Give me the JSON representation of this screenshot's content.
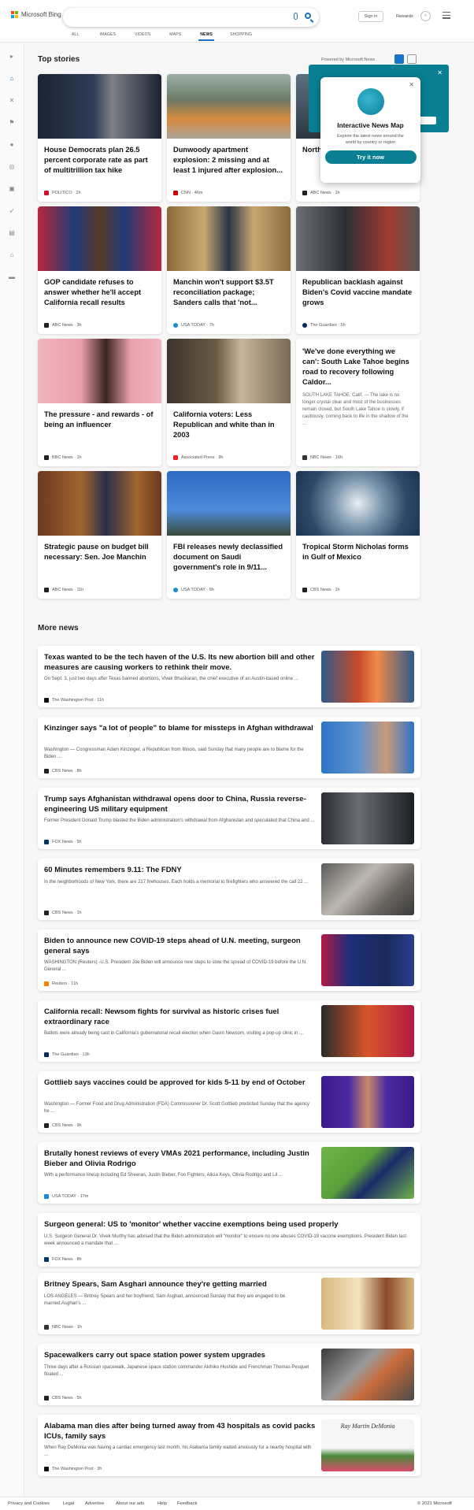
{
  "header": {
    "brand": "Microsoft Bing",
    "signin": "Sign in",
    "rewards": "Rewards"
  },
  "tabs": [
    "ALL",
    "IMAGES",
    "VIDEOS",
    "MAPS",
    "NEWS",
    "SHOPPING"
  ],
  "top": {
    "title": "Top stories",
    "powered": "Powered by Microsoft News"
  },
  "popup": {
    "title": "Interactive News Map",
    "desc": "Explore the latest news around the world by country or region",
    "button": "Try it now"
  },
  "cards": [
    {
      "title": "House Democrats plan 26.5 percent corporate rate as part of multitrillion tax hike",
      "source": "POLITICO · 2h",
      "logo": "#c8102e"
    },
    {
      "title": "Dunwoody apartment explosion: 2 missing and at least 1 injured after explosion...",
      "source": "CNN · 46m",
      "logo": "#cc0000"
    },
    {
      "title": "North... range...",
      "source": "ABC News · 1h",
      "logo": "#222"
    },
    {
      "title": "GOP candidate refuses to answer whether he'll accept California recall results",
      "source": "ABC News · 3h",
      "logo": "#222"
    },
    {
      "title": "Manchin won't support $3.5T reconciliation package; Sanders calls that 'not...",
      "source": "USA TODAY · 7h",
      "logo": "#1a8bd8"
    },
    {
      "title": "Republican backlash against Biden's Covid vaccine mandate grows",
      "source": "The Guardian · 5h",
      "logo": "#052962"
    },
    {
      "title": "The pressure - and rewards - of being an influencer",
      "source": "BBC News · 1h",
      "logo": "#222"
    },
    {
      "title": "California voters: Less Republican and white than in 2003",
      "source": "Associated Press · 9h",
      "logo": "#e22"
    },
    {
      "title": "'We've done everything we can': South Lake Tahoe begins road to recovery following Caldor...",
      "abstract": "SOUTH LAKE TAHOE, Calif. — The lake is no longer crystal clear and most of the businesses remain closed, but South Lake Tahoe is slowly, if cautiously, coming back to life in the shadow of the ...",
      "source": "NBC News · 16h",
      "logo": "#333"
    },
    {
      "title": "Strategic pause on budget bill necessary: Sen. Joe Manchin",
      "source": "ABC News · 11h",
      "logo": "#222"
    },
    {
      "title": "FBI releases newly declassified document on Saudi government's role in 9/11...",
      "source": "USA TODAY · 6h",
      "logo": "#1a8bd8"
    },
    {
      "title": "Tropical Storm Nicholas forms in Gulf of Mexico",
      "source": "CBS News · 1h",
      "logo": "#222"
    }
  ],
  "more": {
    "title": "More news"
  },
  "news": [
    {
      "title": "Texas wanted to be the tech haven of the U.S. Its new abortion bill and other measures are causing workers to rethink their move.",
      "snippet": "On Sept. 3, just two days after Texas banned abortions, Vivek Bhaskaran, the chief executive of an Austin-based online ...",
      "source": "The Washington Post · 11h",
      "logo": "#111"
    },
    {
      "title": "Kinzinger says \"a lot of people\" to blame for missteps in Afghan withdrawal",
      "snippet": "Washington — Congressman Adam Kinzinger, a Republican from Illinois, said Sunday that many people are to blame for the Biden ...",
      "source": "CBS News · 8h",
      "logo": "#222"
    },
    {
      "title": "Trump says Afghanistan withdrawal opens door to China, Russia reverse-engineering US military equipment",
      "snippet": "Former President Donald Trump blasted the Biden administration's withdrawal from Afghanistan and speculated that China and ...",
      "source": "FOX News · 5h",
      "logo": "#003366"
    },
    {
      "title": "60 Minutes remembers 9.11: The FDNY",
      "snippet": "In the neighborhoods of New York, there are 217 firehouses. Each holds a memorial to firefighters who answered the call 22 ...",
      "source": "CBS News · 1h",
      "logo": "#222"
    },
    {
      "title": "Biden to announce new COVID-19 steps ahead of U.N. meeting, surgeon general says",
      "snippet": "WASHINGTON (Reuters) -U.S. President Joe Biden will announce new steps to slow the spread of COVID-19 before the U.N. General ...",
      "source": "Reuters · 11h",
      "logo": "#ff8000"
    },
    {
      "title": "California recall: Newsom fights for survival as historic crises fuel extraordinary race",
      "snippet": "Ballots were already being cast in California's gubernatorial recall election when Gavin Newsom, visiting a pop-up clinic in ...",
      "source": "The Guardian · 13h",
      "logo": "#052962"
    },
    {
      "title": "Gottlieb says vaccines could be approved for kids 5-11 by end of October",
      "snippet": "Washington — Former Food and Drug Administration (FDA) Commissioner Dr. Scott Gottlieb predicted Sunday that the agency he ...",
      "source": "CBS News · 9h",
      "logo": "#222"
    },
    {
      "title": "Brutally honest reviews of every VMAs 2021 performance, including Justin Bieber and Olivia Rodrigo",
      "snippet": "With a performance lineup including Ed Sheeran, Justin Bieber, Foo Fighters, Alicia Keys, Olivia Rodrigo and Lil ...",
      "source": "USA TODAY · 17m",
      "logo": "#1a8bd8"
    },
    {
      "title": "Surgeon general: US to 'monitor' whether vaccine exemptions being used properly",
      "snippet": "U.S. Surgeon General Dr. Vivek Murthy has advised that the Biden administration will \"monitor\" to ensure no one abuses COVID-19 vaccine exemptions. President Biden last week announced a mandate that ...",
      "source": "FOX News · 8h",
      "logo": "#003366"
    },
    {
      "title": "Britney Spears, Sam Asghari announce they're getting married",
      "snippet": "LOS ANGELES — Britney Spears and her boyfriend, Sam Asghari, announced Sunday that they are engaged to be married.Asghari's ...",
      "source": "NBC News · 1h",
      "logo": "#333"
    },
    {
      "title": "Spacewalkers carry out space station power system upgrades",
      "snippet": "Three days after a Russian spacewalk, Japanese space station commander Akihiko Hoshide and Frenchman Thomas Pesquet floated ...",
      "source": "CBS News · 5h",
      "logo": "#222"
    },
    {
      "title": "Alabama man dies after being turned away from 43 hospitals as covid packs ICUs, family says",
      "snippet": "When Ray DeMonia was having a cardiac emergency last month, his Alabama family waited anxiously for a nearby hospital with ...",
      "source": "The Washington Post · 3h",
      "logo": "#111",
      "caption": "Ray Martin DeMonia"
    }
  ],
  "footer": {
    "links": [
      "Privacy and Cookies",
      "Legal",
      "Advertise",
      "About our ads",
      "Help",
      "Feedback"
    ],
    "copyright": "© 2021 Microsoft"
  }
}
